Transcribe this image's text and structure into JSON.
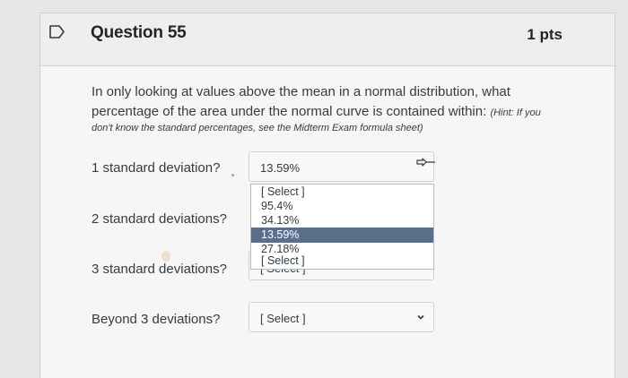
{
  "question": {
    "title": "Question 55",
    "points": "1 pts",
    "text": "In only looking at values above the mean in a normal distribution, what percentage of the area under the normal curve is contained within:",
    "hint_inline": "(Hint: If you",
    "hint_continued": "don't know the standard percentages, see the Midterm Exam formula sheet)"
  },
  "rows": [
    {
      "label": "1 standard deviation?",
      "selected": "13.59%"
    },
    {
      "label": "2 standard deviations?"
    },
    {
      "label": "3 standard deviations?",
      "selected": "[ Select ]"
    },
    {
      "label": "Beyond 3 deviations?",
      "selected": "[ Select ]"
    }
  ],
  "dropdown": {
    "options": [
      "[ Select ]",
      "95.4%",
      "34.13%",
      "13.59%",
      "27.18%",
      "[ Select ]"
    ],
    "highlighted": "13.59%"
  },
  "icons": {
    "flag": "bookmark-flag-icon",
    "chevron": "chevron-down-icon",
    "cursor": "pointer-hand-icon"
  },
  "colors": {
    "highlight": "#5b6f8b",
    "background": "#f7f6f6"
  }
}
